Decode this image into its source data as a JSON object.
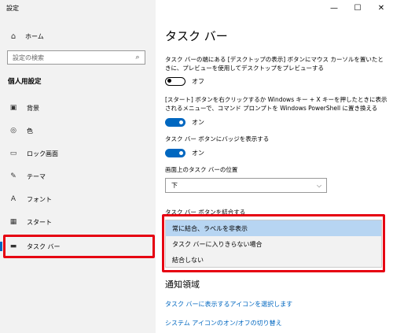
{
  "window": {
    "title": "設定",
    "minimize": "—",
    "maximize": "☐",
    "close": "✕"
  },
  "sidebar": {
    "home": "ホーム",
    "search_placeholder": "設定の検索",
    "section": "個人用設定",
    "items": [
      {
        "label": "背景",
        "icon": "image-icon"
      },
      {
        "label": "色",
        "icon": "palette-icon"
      },
      {
        "label": "ロック画面",
        "icon": "lock-screen-icon"
      },
      {
        "label": "テーマ",
        "icon": "theme-brush-icon"
      },
      {
        "label": "フォント",
        "icon": "font-icon"
      },
      {
        "label": "スタート",
        "icon": "start-grid-icon"
      },
      {
        "label": "タスク バー",
        "icon": "taskbar-icon",
        "selected": true
      }
    ]
  },
  "main": {
    "title": "タスク バー",
    "peek_desc": "タスク バーの端にある [デスクトップの表示] ボタンにマウス カーソルを置いたときに、プレビューを使用してデスクトップをプレビューする",
    "peek_state": "オフ",
    "powershell_desc": "[スタート] ボタンを右クリックするか Windows キー + X キーを押したときに表示されるメニューで、コマンド プロンプトを Windows PowerShell に置き換える",
    "powershell_state": "オン",
    "badges_desc": "タスク バー ボタンにバッジを表示する",
    "badges_state": "オン",
    "location_label": "画面上のタスク バーの位置",
    "location_value": "下",
    "combine_label": "タスク バー ボタンを結合する",
    "combine_options": [
      {
        "label": "常に結合、ラベルを非表示",
        "selected": true
      },
      {
        "label": "タスク バーに入りきらない場合"
      },
      {
        "label": "結合しない"
      }
    ],
    "notif_title": "通知領域",
    "link_icons": "タスク バーに表示するアイコンを選択します",
    "link_system": "システム アイコンのオン/オフの切り替え"
  },
  "colors": {
    "accent": "#0067c0",
    "highlight": "#e60012",
    "selected_option": "#b7d5f2"
  }
}
